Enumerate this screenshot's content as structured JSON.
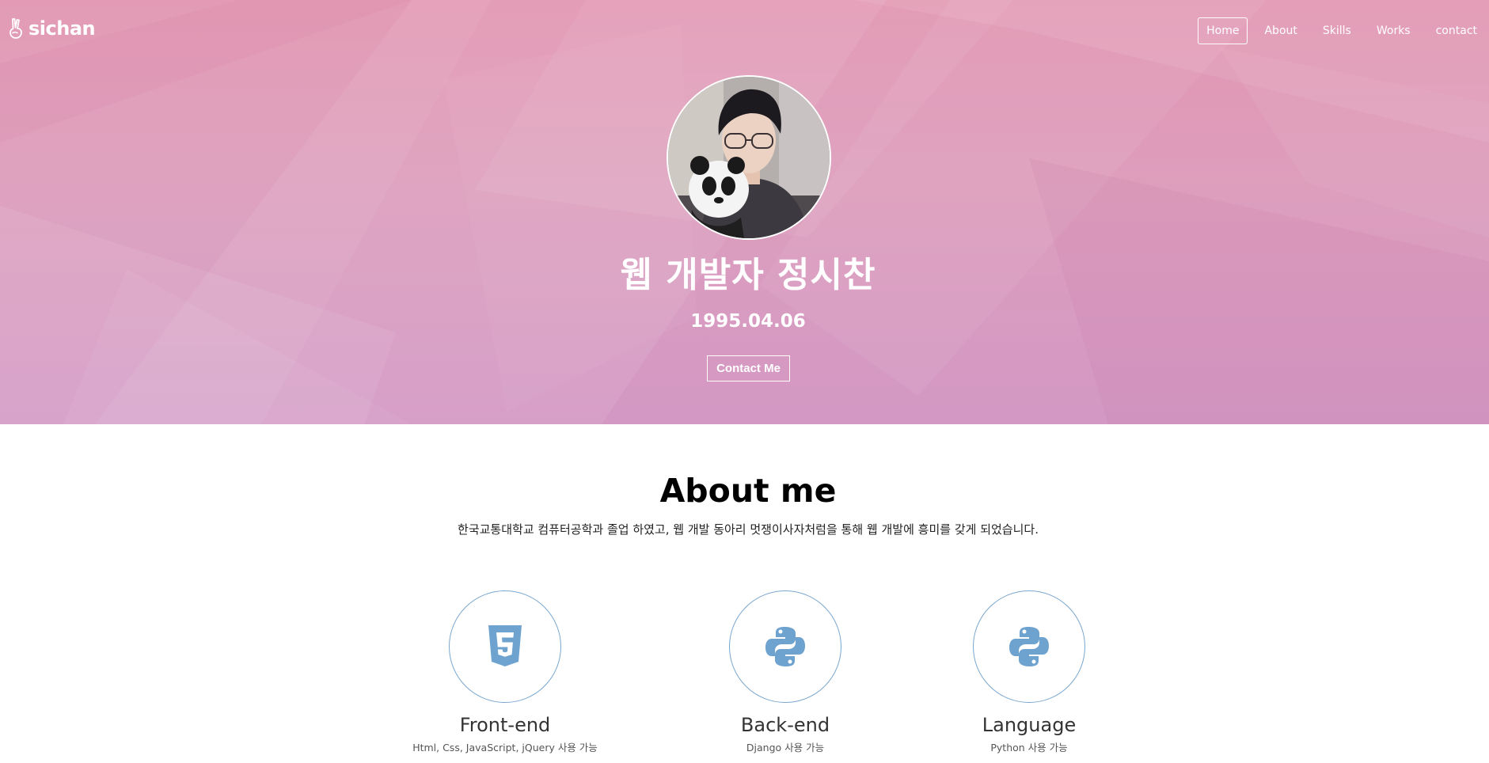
{
  "brand": {
    "name": "sichan",
    "icon": "victory-hand-icon"
  },
  "nav": {
    "items": [
      {
        "label": "Home",
        "active": true
      },
      {
        "label": "About",
        "active": false
      },
      {
        "label": "Skills",
        "active": false
      },
      {
        "label": "Works",
        "active": false
      },
      {
        "label": "contact",
        "active": false
      }
    ]
  },
  "hero": {
    "title": "웹 개발자 정시찬",
    "birthdate": "1995.04.06",
    "contact_button": "Contact Me",
    "background_top": "#e296b1",
    "background_bottom": "#d398c4"
  },
  "about": {
    "title": "About me",
    "description": "한국교통대학교 컴퓨터공학과 졸업 하였고, 웹 개발 동아리 멋쟁이사자처럼을 통해 웹 개발에 흥미를 갖게 되었습니다."
  },
  "skills": [
    {
      "title": "Front-end",
      "desc": "Html, Css, JavaScript, jQuery 사용 가능",
      "icon": "html5-icon"
    },
    {
      "title": "Back-end",
      "desc": "Django 사용 가능",
      "icon": "python-icon"
    },
    {
      "title": "Language",
      "desc": "Python 사용 가능",
      "icon": "python-icon"
    }
  ],
  "colors": {
    "accent_blue": "#6fa3cf",
    "circle_border": "#7aa7cf"
  }
}
